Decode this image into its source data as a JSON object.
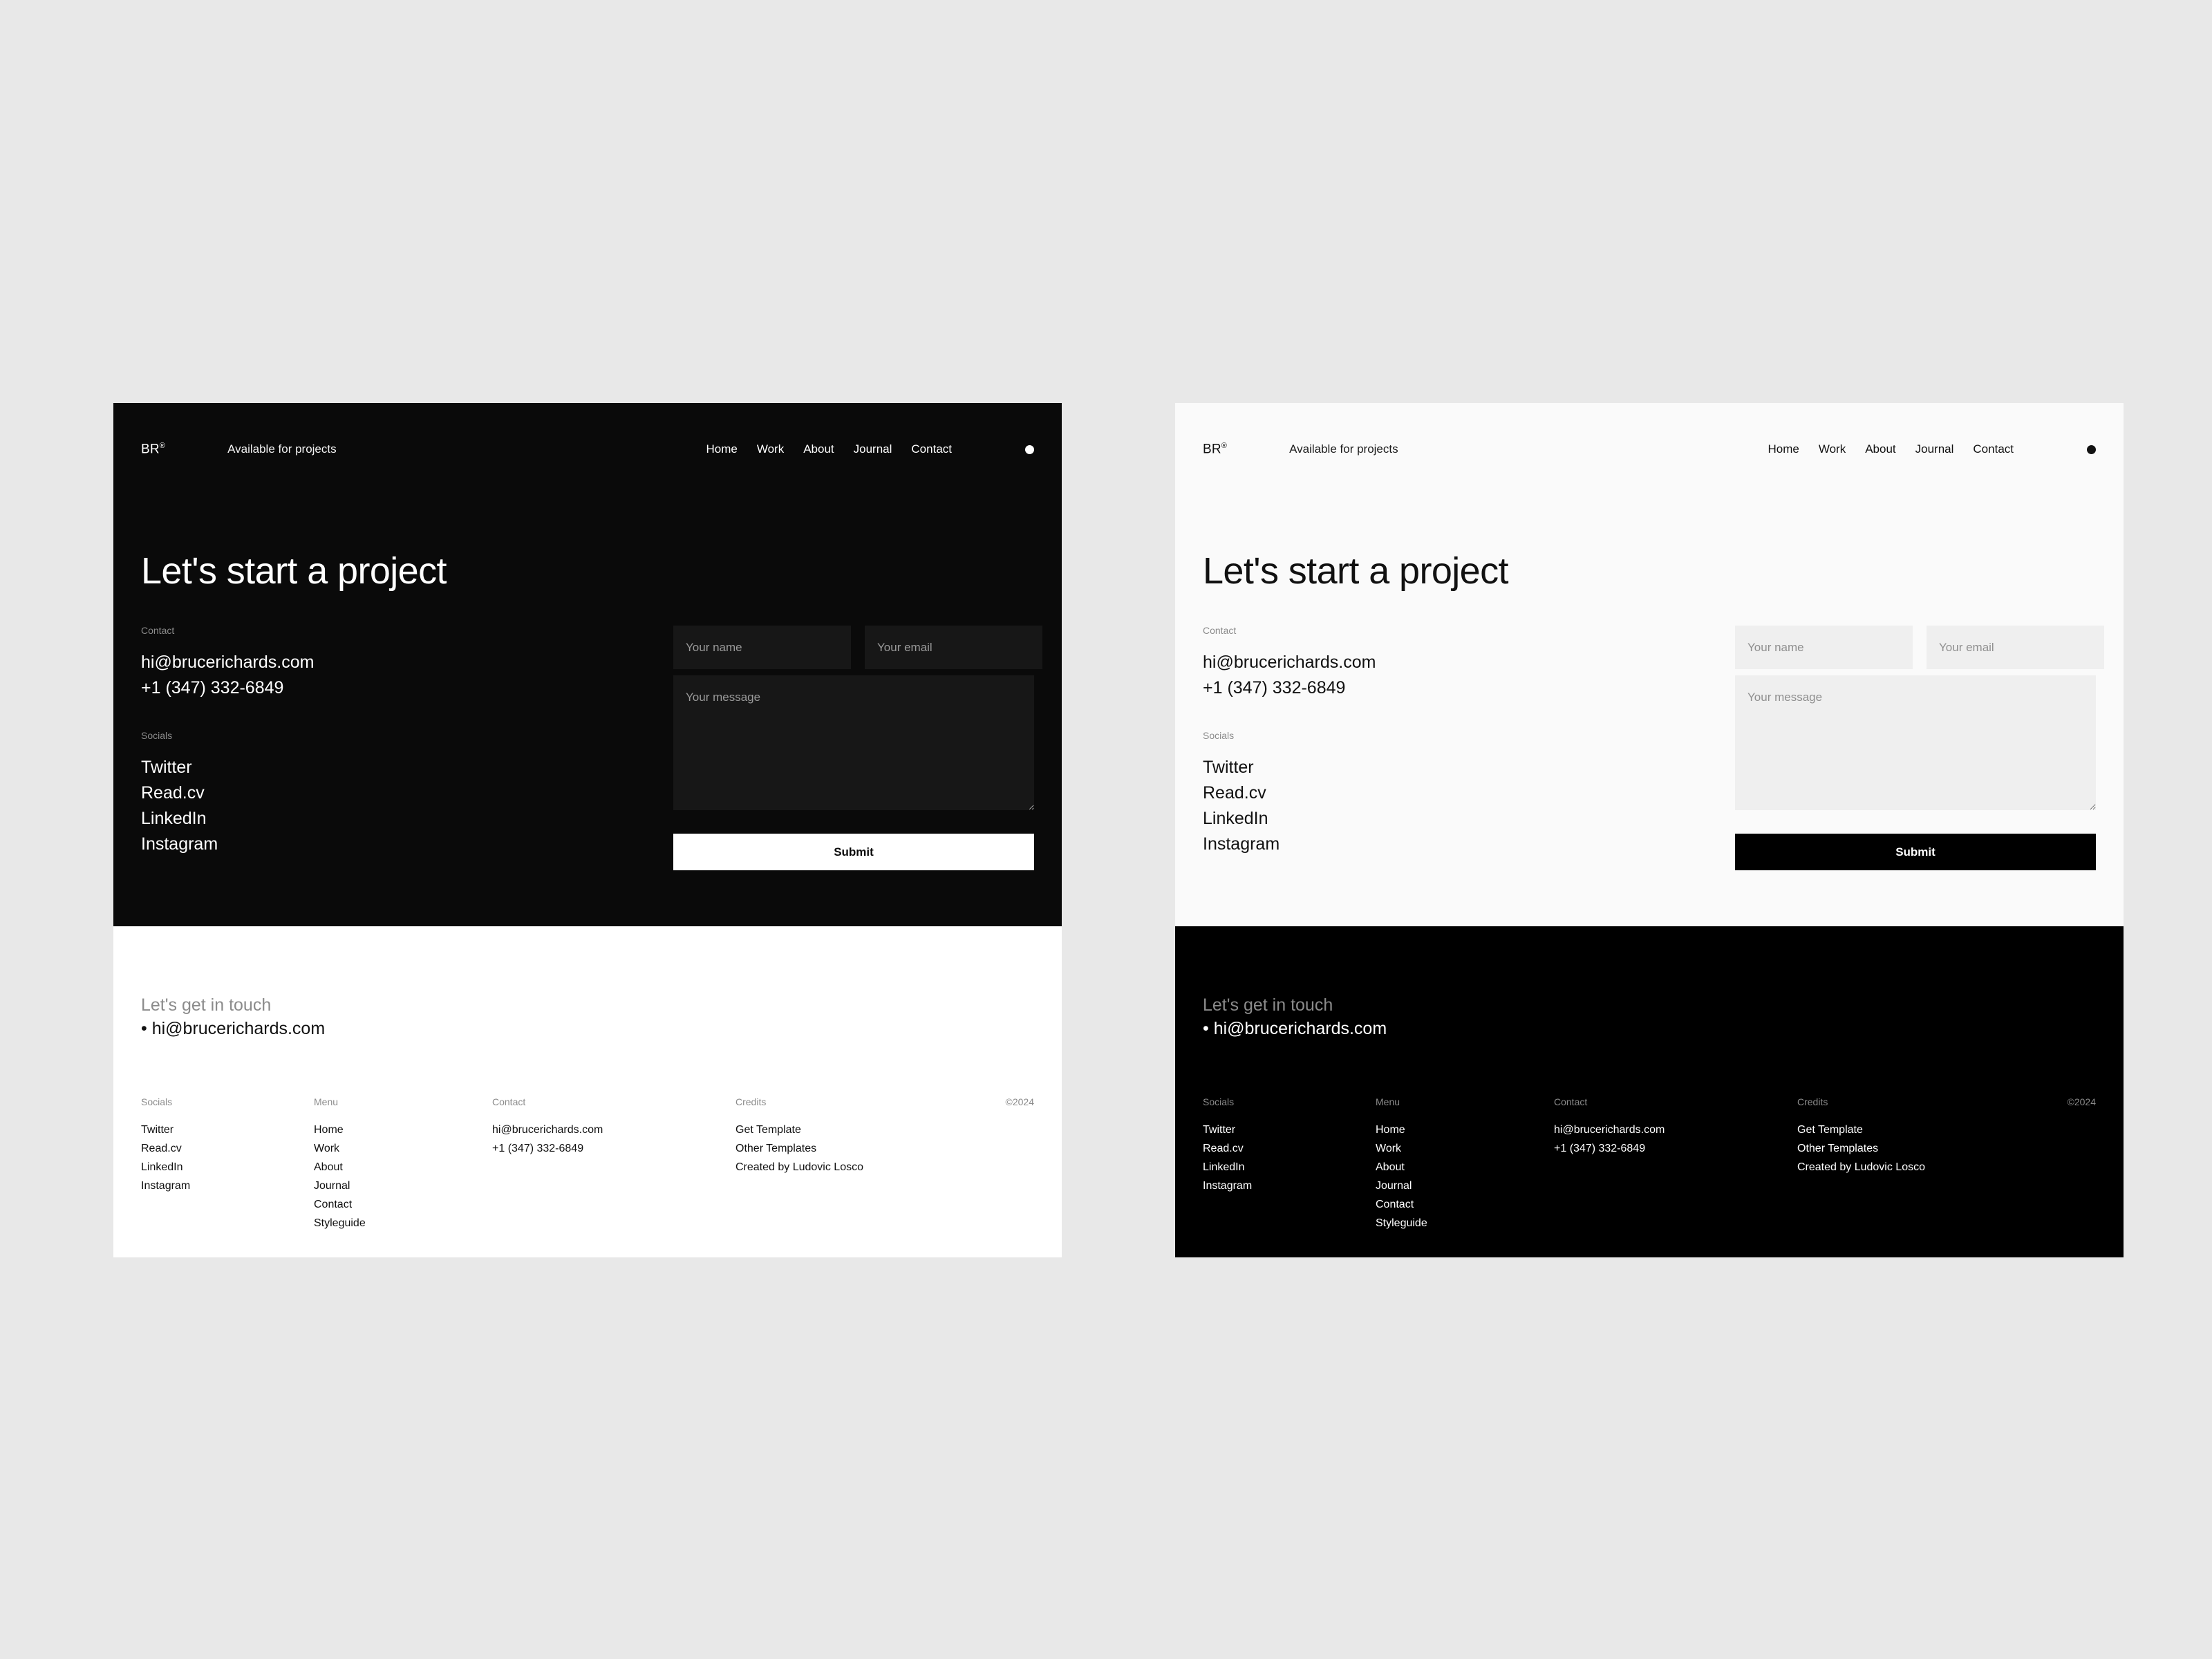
{
  "theme": {
    "page_background": "#e8e8e8",
    "dark_surface": "#0a0a0a",
    "light_surface": "#fafafa",
    "muted_text": "#8b8b8b",
    "dark_field": "#171717",
    "light_field": "#efefef"
  },
  "nav": {
    "brand": "BR",
    "brand_mark": "®",
    "availability": "Available for projects",
    "links": [
      {
        "label": "Home"
      },
      {
        "label": "Work"
      },
      {
        "label": "About"
      },
      {
        "label": "Journal"
      },
      {
        "label": "Contact"
      }
    ],
    "dot_icon": "menu-dot-icon"
  },
  "hero": {
    "title": "Let's start a project",
    "contact_label": "Contact",
    "email": "hi@brucerichards.com",
    "phone": "+1 (347) 332-6849",
    "socials_label": "Socials",
    "socials": [
      {
        "label": "Twitter"
      },
      {
        "label": "Read.cv"
      },
      {
        "label": "LinkedIn"
      },
      {
        "label": "Instagram"
      }
    ]
  },
  "form": {
    "name_placeholder": "Your name",
    "email_placeholder": "Your email",
    "message_placeholder": "Your message",
    "name_value": "",
    "email_value": "",
    "message_value": "",
    "submit_label": "Submit"
  },
  "footer": {
    "get_in_touch_label": "Let's get in touch",
    "get_in_touch_email": "• hi@brucerichards.com",
    "copyright": "©2024",
    "columns": {
      "socials": {
        "head": "Socials",
        "items": [
          {
            "label": "Twitter"
          },
          {
            "label": "Read.cv"
          },
          {
            "label": "LinkedIn"
          },
          {
            "label": "Instagram"
          }
        ]
      },
      "menu": {
        "head": "Menu",
        "items": [
          {
            "label": "Home"
          },
          {
            "label": "Work"
          },
          {
            "label": "About"
          },
          {
            "label": "Journal"
          },
          {
            "label": "Contact"
          },
          {
            "label": "Styleguide"
          }
        ]
      },
      "contact": {
        "head": "Contact",
        "items": [
          {
            "label": "hi@brucerichards.com"
          },
          {
            "label": "+1 (347) 332-6849"
          }
        ]
      },
      "credits": {
        "head": "Credits",
        "items": [
          {
            "label": "Get Template"
          },
          {
            "label": "Other Templates"
          },
          {
            "label": "Created by Ludovic Losco"
          }
        ]
      }
    }
  },
  "panels": [
    {
      "id": "dark",
      "name": "dark-variant"
    },
    {
      "id": "light",
      "name": "light-variant"
    }
  ]
}
